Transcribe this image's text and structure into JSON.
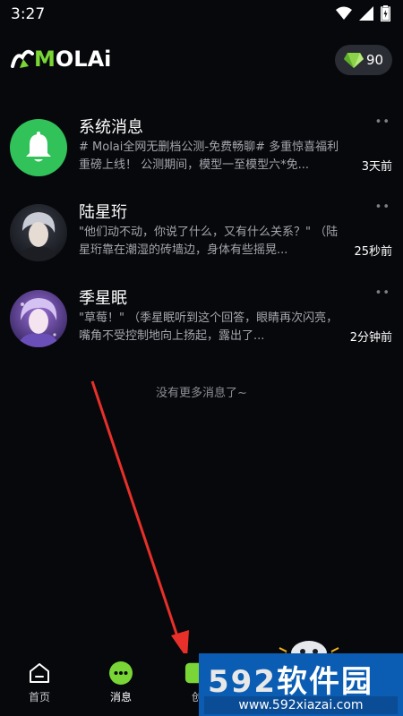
{
  "status_bar": {
    "time": "3:27"
  },
  "header": {
    "logo_text_a": "M",
    "logo_text_b": "OLAi",
    "gem_count": "90"
  },
  "messages": [
    {
      "title": "系统消息",
      "preview": "# Molai全网无删档公测-免费畅聊# 多重惊喜福利重磅上线！ 公测期间，模型一至模型六*免...",
      "time": "3天前",
      "more": "••"
    },
    {
      "title": "陆星珩",
      "preview": "\"他们动不动，你说了什么，又有什么关系？\" （陆星珩靠在潮湿的砖墙边，身体有些摇晃...",
      "time": "25秒前",
      "more": "••"
    },
    {
      "title": "季星眠",
      "preview": "\"草莓！\" （季星眠听到这个回答，眼睛再次闪亮，嘴角不受控制地向上扬起，露出了...",
      "time": "2分钟前",
      "more": "••"
    }
  ],
  "no_more_text": "没有更多消息了~",
  "nav": {
    "home": "首页",
    "messages": "消息",
    "create": "创"
  },
  "watermark": {
    "brand_num": "592",
    "brand_text": "软件园",
    "url": "www.592xiazai.com"
  },
  "colors": {
    "accent_green": "#7ad636",
    "badge_bg": "#2a2d33",
    "system_avatar": "#31c25a",
    "watermark_blue": "#0b5db3"
  }
}
